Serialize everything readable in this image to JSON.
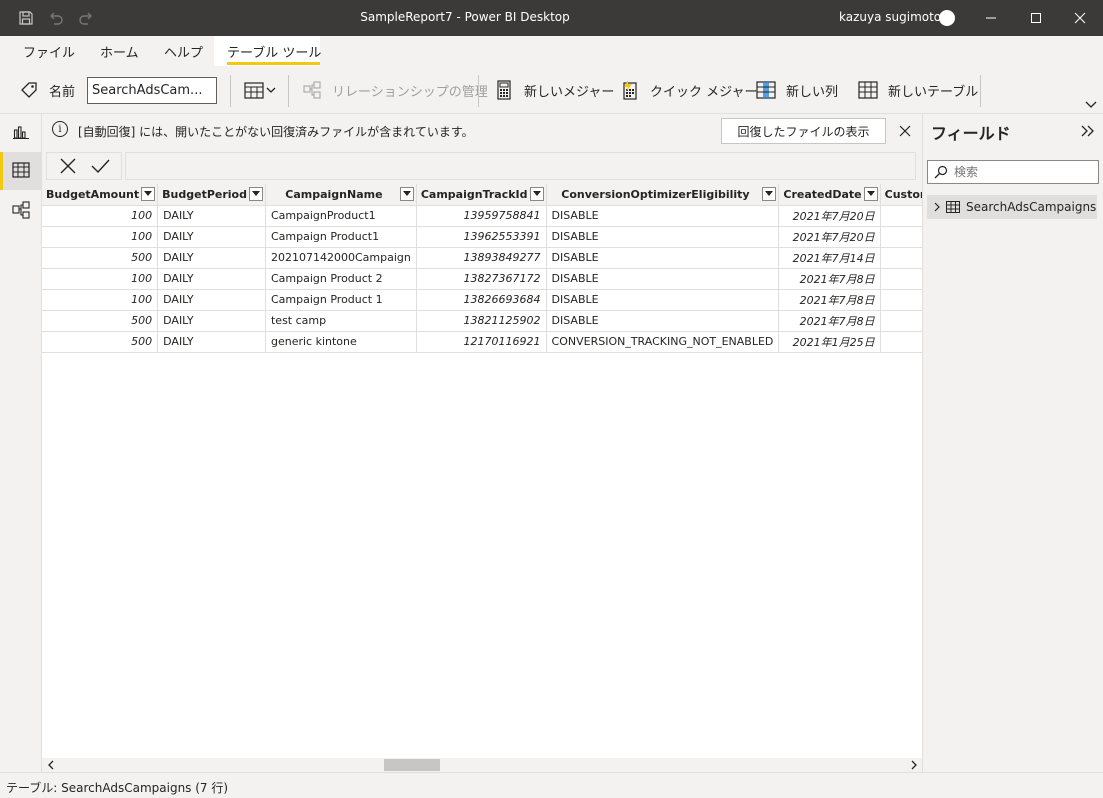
{
  "window": {
    "title": "SampleReport7 - Power BI Desktop",
    "user": "kazuya sugimoto"
  },
  "tabs": [
    {
      "label": "ファイル"
    },
    {
      "label": "ホーム"
    },
    {
      "label": "ヘルプ"
    },
    {
      "label": "テーブル ツール",
      "active": true
    }
  ],
  "ribbon": {
    "name_label": "名前",
    "name_value": "SearchAdsCam...",
    "manage_relationships": "リレーションシップの管理",
    "new_measure": "新しいメジャー",
    "quick_measure": "クイック メジャー",
    "new_column": "新しい列",
    "new_table": "新しいテーブル"
  },
  "infobar": {
    "message": "[自動回復] には、開いたことがない回復済みファイルが含まれています。",
    "button": "回復したファイルの表示"
  },
  "grid": {
    "columns": [
      {
        "name": "BudgetAmount"
      },
      {
        "name": "BudgetPeriod"
      },
      {
        "name": "CampaignName"
      },
      {
        "name": "CampaignTrackId"
      },
      {
        "name": "ConversionOptimizerEligibility"
      },
      {
        "name": "CreatedDate"
      },
      {
        "name": "CustomParametersIsRen"
      }
    ],
    "rows": [
      [
        "100",
        "DAILY",
        "CampaignProduct1",
        "13959758841",
        "DISABLE",
        "2021年7月20日",
        ""
      ],
      [
        "100",
        "DAILY",
        "Campaign Product1",
        "13962553391",
        "DISABLE",
        "2021年7月20日",
        ""
      ],
      [
        "500",
        "DAILY",
        "202107142000Campaign",
        "13893849277",
        "DISABLE",
        "2021年7月14日",
        ""
      ],
      [
        "100",
        "DAILY",
        "Campaign Product 2",
        "13827367172",
        "DISABLE",
        "2021年7月8日",
        ""
      ],
      [
        "100",
        "DAILY",
        "Campaign Product 1",
        "13826693684",
        "DISABLE",
        "2021年7月8日",
        ""
      ],
      [
        "500",
        "DAILY",
        "test camp",
        "13821125902",
        "DISABLE",
        "2021年7月8日",
        ""
      ],
      [
        "500",
        "DAILY",
        "generic kintone",
        "12170116921",
        "CONVERSION_TRACKING_NOT_ENABLED",
        "2021年1月25日",
        ""
      ]
    ]
  },
  "fields": {
    "title": "フィールド",
    "search_placeholder": "検索",
    "table_name": "SearchAdsCampaigns"
  },
  "status": {
    "text": "テーブル: SearchAdsCampaigns (7 行)"
  },
  "colors": {
    "accent": "#f2c811",
    "titlebar": "#3b3a39"
  }
}
